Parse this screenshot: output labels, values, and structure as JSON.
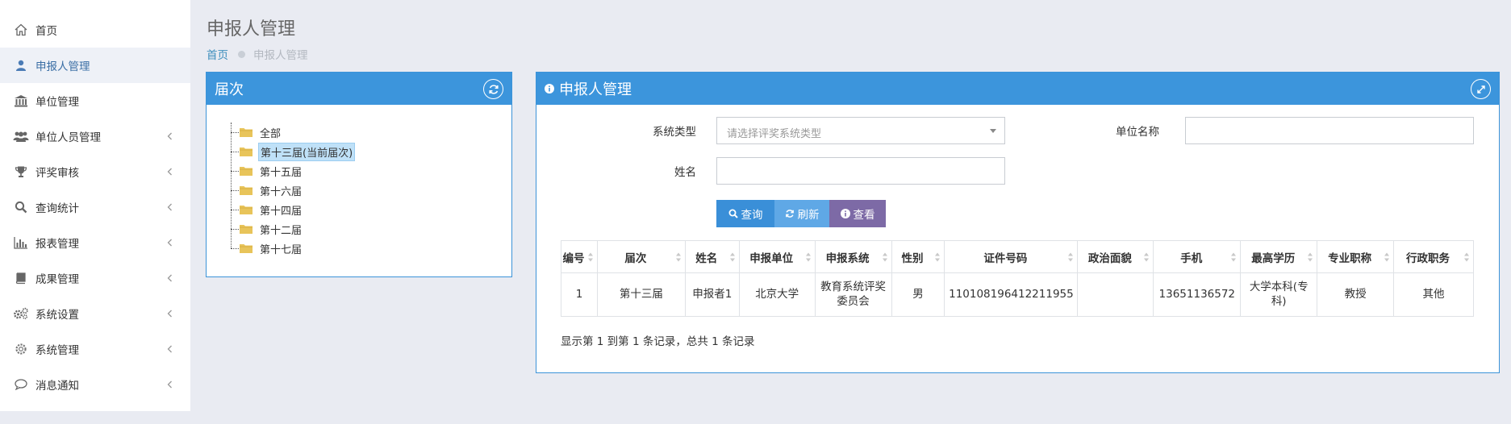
{
  "sidebar": {
    "items": [
      {
        "label": "首页",
        "icon": "home-icon",
        "active": false,
        "chevron": false
      },
      {
        "label": "申报人管理",
        "icon": "user-icon",
        "active": true,
        "chevron": false
      },
      {
        "label": "单位管理",
        "icon": "bank-icon",
        "active": false,
        "chevron": false
      },
      {
        "label": "单位人员管理",
        "icon": "users-icon",
        "active": false,
        "chevron": true
      },
      {
        "label": "评奖审核",
        "icon": "trophy-icon",
        "active": false,
        "chevron": true
      },
      {
        "label": "查询统计",
        "icon": "search-icon",
        "active": false,
        "chevron": true
      },
      {
        "label": "报表管理",
        "icon": "bar-chart-icon",
        "active": false,
        "chevron": true
      },
      {
        "label": "成果管理",
        "icon": "book-icon",
        "active": false,
        "chevron": true
      },
      {
        "label": "系统设置",
        "icon": "cogs-icon",
        "active": false,
        "chevron": true
      },
      {
        "label": "系统管理",
        "icon": "gear-icon",
        "active": false,
        "chevron": true
      },
      {
        "label": "消息通知",
        "icon": "comment-icon",
        "active": false,
        "chevron": true
      }
    ]
  },
  "header": {
    "title": "申报人管理",
    "breadcrumb_home": "首页",
    "breadcrumb_current": "申报人管理"
  },
  "session_panel": {
    "title": "届次",
    "tree": [
      {
        "label": "全部",
        "selected": false
      },
      {
        "label": "第十三届(当前届次)",
        "selected": true
      },
      {
        "label": "第十五届",
        "selected": false
      },
      {
        "label": "第十六届",
        "selected": false
      },
      {
        "label": "第十四届",
        "selected": false
      },
      {
        "label": "第十二届",
        "selected": false
      },
      {
        "label": "第十七届",
        "selected": false
      }
    ]
  },
  "main_panel": {
    "title": "申报人管理",
    "form": {
      "system_type_label": "系统类型",
      "system_type_placeholder": "请选择评奖系统类型",
      "unit_name_label": "单位名称",
      "unit_name_value": "",
      "name_label": "姓名",
      "name_value": ""
    },
    "buttons": {
      "query": "查询",
      "refresh": "刷新",
      "view": "查看"
    },
    "table": {
      "columns": [
        "编号",
        "届次",
        "姓名",
        "申报单位",
        "申报系统",
        "性别",
        "证件号码",
        "政治面貌",
        "手机",
        "最高学历",
        "专业职称",
        "行政职务"
      ],
      "rows": [
        [
          "1",
          "第十三届",
          "申报者1",
          "北京大学",
          "教育系统评奖委员会",
          "男",
          "110108196412211955",
          "",
          "13651136572",
          "大学本科(专科)",
          "教授",
          "其他"
        ]
      ]
    },
    "summary": "显示第 1 到第 1 条记录，总共 1 条记录"
  },
  "colors": {
    "panel_header": "#3c95dc",
    "btn_query": "#3a8fd8",
    "btn_refresh": "#5fa8e6",
    "btn_view": "#7d6aa6",
    "sidebar_active_bg": "#eef1f7",
    "folder": "#e8c45a"
  }
}
